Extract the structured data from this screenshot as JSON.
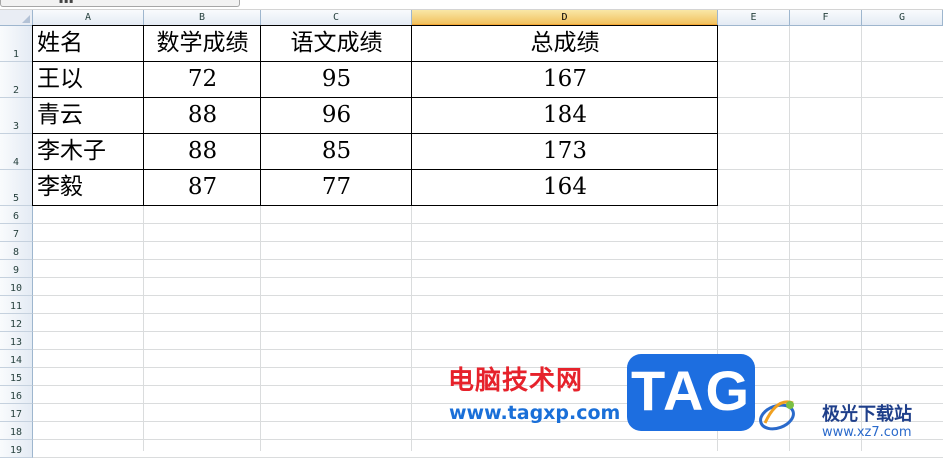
{
  "columns": [
    "A",
    "B",
    "C",
    "D",
    "E",
    "F",
    "G"
  ],
  "selected_column": "D",
  "rows": [
    "1",
    "2",
    "3",
    "4",
    "5",
    "6",
    "7",
    "8",
    "9",
    "10",
    "11",
    "12",
    "13",
    "14",
    "15",
    "16",
    "17",
    "18",
    "19"
  ],
  "table": {
    "headers": [
      "姓名",
      "数学成绩",
      "语文成绩",
      "总成绩"
    ],
    "records": [
      [
        "王以",
        "72",
        "95",
        "167"
      ],
      [
        "青云",
        "88",
        "96",
        "184"
      ],
      [
        "李木子",
        "88",
        "85",
        "173"
      ],
      [
        "李毅",
        "87",
        "77",
        "164"
      ]
    ]
  },
  "watermark": {
    "site_name": "电脑技术网",
    "site_url": "www.tagxp.com",
    "badge": "TAG",
    "partner_name": "极光下载站",
    "partner_url": "www.xz7.com"
  },
  "colors": {
    "header_bg": "#e4ebf4",
    "selected_header": "#f1c15f",
    "gridline": "#dadcdd",
    "watermark_red": "#e6222b",
    "watermark_blue": "#1a6fd8",
    "badge_blue": "#1d6ee0"
  }
}
